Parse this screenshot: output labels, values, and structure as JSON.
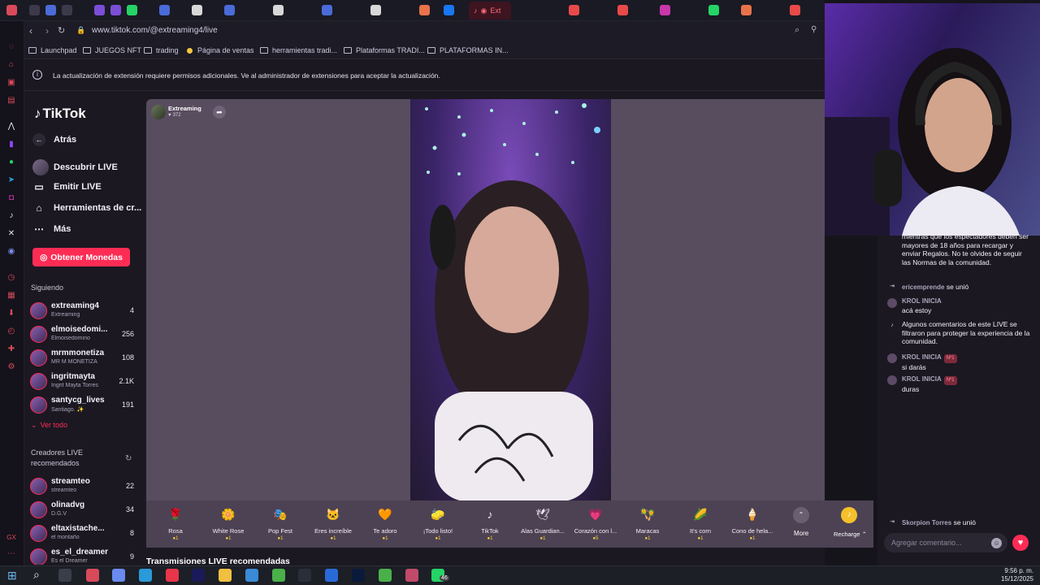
{
  "browser": {
    "url": "www.tiktok.com/@extreaming4/live",
    "active_tab_label": "Ext",
    "bookmarks": [
      "Launchpad",
      "JUEGOS NFT",
      "trading",
      "Página de ventas",
      "herramientas tradi...",
      "Plataformas TRADI...",
      "PLATAFORMAS IN..."
    ],
    "info_message": "La actualización de extensión requiere permisos adicionales. Ve al administrador de extensiones para aceptar la actualización."
  },
  "sidebar": {
    "brand": "TikTok",
    "back": "Atrás",
    "nav": [
      "Descubrir LIVE",
      "Emitir LIVE",
      "Herramientas de cr...",
      "Más"
    ],
    "coins_button": "Obtener Monedas",
    "following_title": "Siguiendo",
    "following": [
      {
        "name": "extreaming4",
        "sub": "Extreaming",
        "count": "4"
      },
      {
        "name": "elmoisedomi...",
        "sub": "Elmoisedomino",
        "count": "256"
      },
      {
        "name": "mrmmonetiza",
        "sub": "MR M MONETIZA",
        "count": "108"
      },
      {
        "name": "ingritmayta",
        "sub": "Ingrit Mayta Torres",
        "count": "2.1K"
      },
      {
        "name": "santycg_lives",
        "sub": "Santiago. ✨",
        "count": "191"
      }
    ],
    "see_all": "Ver todo",
    "recommended_title": "Creadores LIVE recomendados",
    "recommended": [
      {
        "name": "streamteo",
        "sub": "streamteo",
        "count": "22"
      },
      {
        "name": "olinadvg",
        "sub": "D.G.V",
        "count": "34"
      },
      {
        "name": "eltaxistache...",
        "sub": "el montaño",
        "count": "8"
      },
      {
        "name": "es_el_dreamer",
        "sub": "Es el Dreamer",
        "count": "9"
      }
    ]
  },
  "stream": {
    "host": "Extreaming",
    "viewers": "372",
    "recommended_header": "Transmisiones LIVE recomendadas"
  },
  "gifts": [
    {
      "label": "Rosa",
      "price": "1",
      "icon": "🌹"
    },
    {
      "label": "White Rose",
      "price": "1",
      "icon": "🌼"
    },
    {
      "label": "Pop Fest",
      "price": "1",
      "icon": "🎭"
    },
    {
      "label": "Eres increíble",
      "price": "1",
      "icon": "🐱"
    },
    {
      "label": "Te adoro",
      "price": "1",
      "icon": "🧡"
    },
    {
      "label": "¡Todo listo!",
      "price": "1",
      "icon": "🧽"
    },
    {
      "label": "TikTok",
      "price": "1",
      "icon": "♪"
    },
    {
      "label": "Alas Guardian...",
      "price": "1",
      "icon": "🕊"
    },
    {
      "label": "Corazón con l...",
      "price": "5",
      "icon": "💗"
    },
    {
      "label": "Maracas",
      "price": "1",
      "icon": "🪇"
    },
    {
      "label": "It's corn",
      "price": "1",
      "icon": "🌽"
    },
    {
      "label": "Cono de hela...",
      "price": "1",
      "icon": "🍦"
    }
  ],
  "gift_more": "More",
  "recharge": "Recharge",
  "chat": {
    "intro": "mientras que los espectadores deben ser mayores de 18 años para recargar y enviar Regalos. No te olvides de seguir las Normas de la comunidad.",
    "messages": [
      {
        "user": "ericemprende",
        "text": "se unió",
        "type": "join"
      },
      {
        "user": "KROL INICIA",
        "text": "acá estoy",
        "type": "msg"
      },
      {
        "user": "",
        "text": "Algunos comentarios de este LIVE se filtraron para proteger la experiencia de la comunidad.",
        "type": "notice"
      },
      {
        "user": "KROL INICIA",
        "badge": "Nº1",
        "text": "si darás",
        "type": "msg"
      },
      {
        "user": "KROL INICIA",
        "badge": "Nº1",
        "text": "duras",
        "type": "msg"
      },
      {
        "user": "Skorpion Torres",
        "text": "se unió",
        "type": "join"
      }
    ],
    "input_placeholder": "Agregar comentario..."
  },
  "taskbar": {
    "time": "9:56 p. m.",
    "date": "15/12/2025",
    "badge": "46"
  },
  "colors": {
    "accent": "#fe2c55",
    "panel": "#1b1822"
  }
}
